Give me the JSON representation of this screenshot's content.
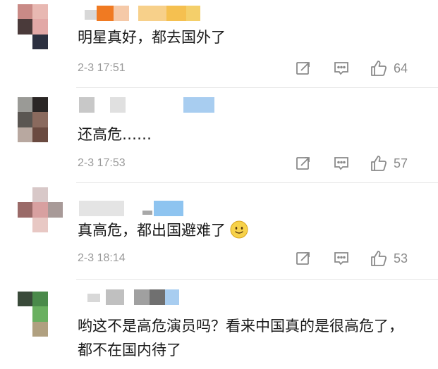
{
  "colors": {
    "text": "#1a1a1a",
    "meta": "#9a9a9a",
    "icon": "#8a8a8a",
    "divider": "#e6e6e6",
    "emoji_face": "#f7d24a"
  },
  "comments": [
    {
      "text": "明星真好，都去国外了",
      "timestamp": "2-3 17:51",
      "likes": "64",
      "avatar_pixels": [
        "#c98a86",
        "#e8b8b2",
        "#ffffff",
        "#4a3a3a",
        "#e2a8a6",
        "#ffffff",
        "#ffffff",
        "#2c3040",
        "#ffffff"
      ],
      "name_blocks": [
        "#d8d8d8",
        "#f07a22",
        "#f5c9a8",
        "#f7d08a",
        "#f5c050",
        "#f4cf6a"
      ]
    },
    {
      "text": "还高危……",
      "timestamp": "2-3 17:53",
      "likes": "57",
      "avatar_pixels": [
        "#9a9a96",
        "#2a2625",
        "#ffffff",
        "#5a5652",
        "#8a6a5e",
        "#ffffff",
        "#b8a8a0",
        "#6a4a40",
        "#ffffff"
      ],
      "name_blocks": [
        "#c8c8c8",
        "#e0e0e0",
        "#a8cdf0"
      ]
    },
    {
      "text": "真高危，都出国避难了",
      "timestamp": "2-3 18:14",
      "likes": "53",
      "avatar_pixels": [
        "#ffffff",
        "#d8c8c8",
        "#ffffff",
        "#9a6a68",
        "#d8a0a0",
        "#a89a98",
        "#ffffff",
        "#e8c8c4",
        "#ffffff"
      ],
      "name_blocks": [
        "#e4e4e4",
        "#a8a8a8",
        "#8ec4f0"
      ]
    },
    {
      "text": "哟这不是高危演员吗？看来中国真的是很高危了，都不在国内待了",
      "avatar_pixels": [
        "#3a4a3a",
        "#4a8a4a",
        "#ffffff",
        "#ffffff",
        "#6ab060",
        "#ffffff",
        "#ffffff",
        "#b0a080",
        "#ffffff"
      ],
      "name_blocks": [
        "#d8d8d8",
        "#c0c0c0",
        "#a0a0a0",
        "#707070",
        "#a8cdf0"
      ]
    }
  ]
}
